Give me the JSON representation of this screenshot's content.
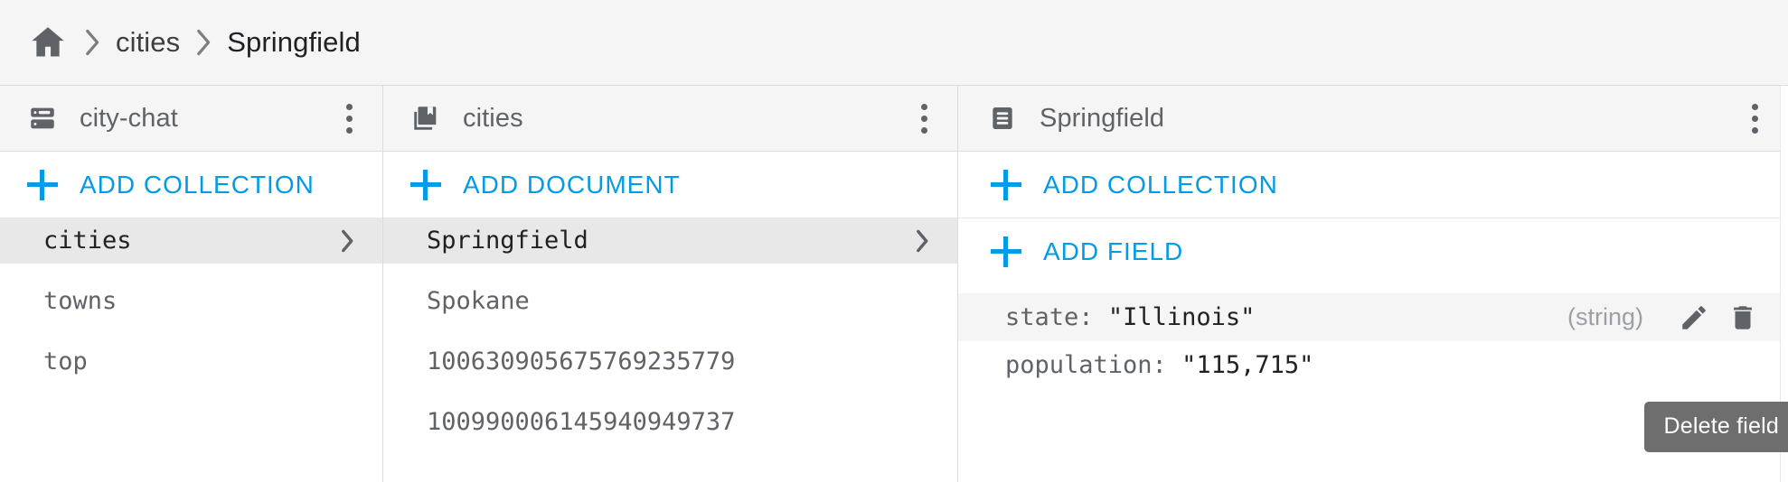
{
  "breadcrumb": {
    "home_icon": "home-icon",
    "separator": "chevron-right-icon",
    "items": [
      {
        "label": "cities"
      },
      {
        "label": "Springfield"
      }
    ]
  },
  "panels": {
    "database": {
      "icon": "database-icon",
      "title": "city-chat",
      "menu_icon": "more-vert-icon",
      "action": {
        "icon": "plus-icon",
        "label": "ADD COLLECTION"
      },
      "rows": [
        {
          "label": "cities",
          "selected": true,
          "chevron": "chevron-right-icon"
        },
        {
          "label": "towns",
          "selected": false
        },
        {
          "label": "top",
          "selected": false
        }
      ]
    },
    "collection": {
      "icon": "collection-icon",
      "title": "cities",
      "menu_icon": "more-vert-icon",
      "action": {
        "icon": "plus-icon",
        "label": "ADD DOCUMENT"
      },
      "rows": [
        {
          "label": "Springfield",
          "selected": true,
          "chevron": "chevron-right-icon"
        },
        {
          "label": "Spokane",
          "selected": false
        },
        {
          "label": "100630905675769235779",
          "selected": false
        },
        {
          "label": "100990006145940949737",
          "selected": false
        }
      ]
    },
    "document": {
      "icon": "document-icon",
      "title": "Springfield",
      "menu_icon": "more-vert-icon",
      "actions": [
        {
          "icon": "plus-icon",
          "label": "ADD COLLECTION"
        },
        {
          "icon": "plus-icon",
          "label": "ADD FIELD"
        }
      ],
      "fields": [
        {
          "key": "state:",
          "value": "\"Illinois\"",
          "type": "(string)",
          "highlighted": true,
          "edit_icon": "pencil-icon",
          "delete_icon": "trash-icon"
        },
        {
          "key": "population:",
          "value": "\"115,715\"",
          "type": "",
          "highlighted": false
        }
      ]
    }
  },
  "tooltip": {
    "label": "Delete field"
  },
  "colors": {
    "accent": "#039be5",
    "header_bg": "#f5f5f5",
    "selected_bg": "#e8e8e8",
    "border": "#dadce0",
    "text_primary": "#202124",
    "text_secondary": "#5f6368",
    "text_muted": "#9aa0a6",
    "tooltip_bg": "#6e6e6e"
  }
}
